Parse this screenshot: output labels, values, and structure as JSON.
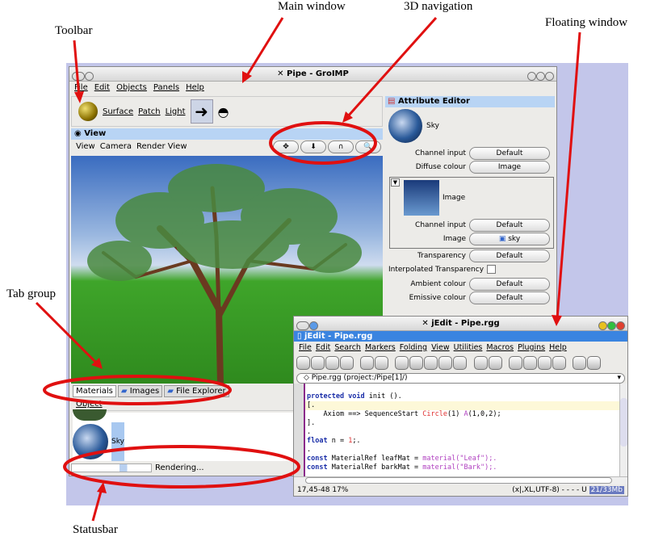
{
  "annotations": {
    "main_window": "Main window",
    "navigation": "3D navigation",
    "toolbar": "Toolbar",
    "floating_window": "Floating window",
    "tab_group": "Tab group",
    "statusbar": "Statusbar",
    "arrow_color": "#e01010"
  },
  "main": {
    "title": "Pipe - GroIMP",
    "menu": [
      "File",
      "Edit",
      "Objects",
      "Panels",
      "Help"
    ],
    "toolbar": {
      "items": [
        "Surface",
        "Patch",
        "Light"
      ]
    },
    "view": {
      "title": "View",
      "menu": [
        "View",
        "Camera",
        "Render View"
      ],
      "nav_buttons": [
        "move-icon",
        "move-down-icon",
        "rotate-icon",
        "zoom-icon"
      ]
    },
    "attribute_editor": {
      "title": "Attribute Editor",
      "material": "Sky",
      "rows": [
        {
          "label": "Channel input",
          "value": "Default"
        },
        {
          "label": "Diffuse colour",
          "value": "Image"
        }
      ],
      "image_block": {
        "name": "Image",
        "rows": [
          {
            "label": "Channel input",
            "value": "Default"
          },
          {
            "label": "Image",
            "value": "sky"
          }
        ]
      },
      "rows2": [
        {
          "label": "Transparency",
          "value": "Default"
        }
      ],
      "interpolated": "Interpolated Transparency",
      "rows3": [
        {
          "label": "Ambient colour",
          "value": "Default"
        },
        {
          "label": "Emissive colour",
          "value": "Default"
        }
      ]
    },
    "tabs": [
      "Materials",
      "Images",
      "File Explorer"
    ],
    "object_menu": "Object",
    "material_item": "Sky",
    "status": "Rendering..."
  },
  "jedit": {
    "title": "jEdit - Pipe.rgg",
    "inner_title": "jEdit - Pipe.rgg",
    "menu": [
      "File",
      "Edit",
      "Search",
      "Markers",
      "Folding",
      "View",
      "Utilities",
      "Macros",
      "Plugins",
      "Help"
    ],
    "buffer": "Pipe.rgg (project:/Pipe[1]/)",
    "code": {
      "l1a": "protected void",
      "l1b": " init ().",
      "l2": "[.",
      "l3a": "    Axiom ==> SequenceStart ",
      "l3b": "Circle",
      "l3c": "(1) ",
      "l3d": "A",
      "l3e": "(1,0,2);",
      "l4": "].",
      "l5": ".",
      "l6a": "float",
      "l6b": " n = ",
      "l6c": "1",
      "l6d": ";.",
      "l7": ".",
      "l8a": "const",
      "l8b": " MaterialRef leafMat = ",
      "l8c": "material",
      "l8d": "(\"Leaf\");.",
      "l9a": "const",
      "l9b": " MaterialRef barkMat = ",
      "l9c": "material",
      "l9d": "(\"Bark\");.",
      "l10": "."
    },
    "status_left": "17,45-48 17%",
    "status_right": "(x|,XL,UTF-8) - - - - U",
    "memory": "21/33Mb"
  }
}
